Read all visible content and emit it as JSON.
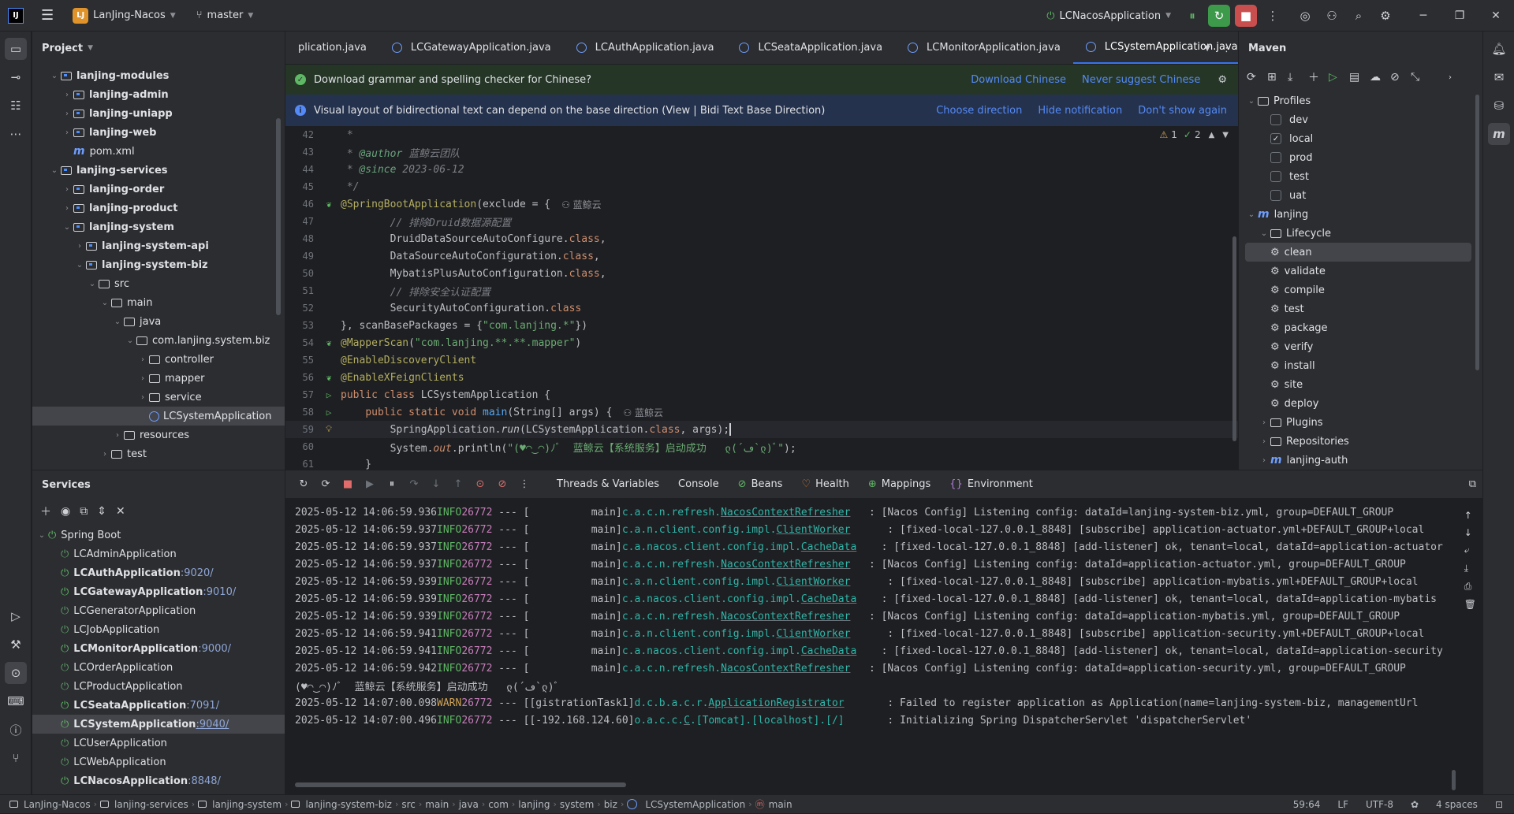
{
  "titlebar": {
    "logo": "IJ",
    "project_badge": "LJ",
    "project_name": "LanJing-Nacos",
    "branch": "master",
    "run_config": "LCNacosApplication"
  },
  "project_panel": {
    "title": "Project",
    "tree": [
      {
        "label": "lanjing-modules",
        "indent": 1,
        "chev": "v",
        "icon": "module",
        "bold": true
      },
      {
        "label": "lanjing-admin",
        "indent": 2,
        "chev": ">",
        "icon": "module",
        "bold": true
      },
      {
        "label": "lanjing-uniapp",
        "indent": 2,
        "chev": ">",
        "icon": "module",
        "bold": true
      },
      {
        "label": "lanjing-web",
        "indent": 2,
        "chev": ">",
        "icon": "module",
        "bold": true
      },
      {
        "label": "pom.xml",
        "indent": 2,
        "chev": "",
        "icon": "maven",
        "bold": false
      },
      {
        "label": "lanjing-services",
        "indent": 1,
        "chev": "v",
        "icon": "module",
        "bold": true
      },
      {
        "label": "lanjing-order",
        "indent": 2,
        "chev": ">",
        "icon": "module",
        "bold": true
      },
      {
        "label": "lanjing-product",
        "indent": 2,
        "chev": ">",
        "icon": "module",
        "bold": true
      },
      {
        "label": "lanjing-system",
        "indent": 2,
        "chev": "v",
        "icon": "module",
        "bold": true
      },
      {
        "label": "lanjing-system-api",
        "indent": 3,
        "chev": ">",
        "icon": "module",
        "bold": true
      },
      {
        "label": "lanjing-system-biz",
        "indent": 3,
        "chev": "v",
        "icon": "module",
        "bold": true
      },
      {
        "label": "src",
        "indent": 4,
        "chev": "v",
        "icon": "folder",
        "bold": false
      },
      {
        "label": "main",
        "indent": 5,
        "chev": "v",
        "icon": "folder",
        "bold": false
      },
      {
        "label": "java",
        "indent": 6,
        "chev": "v",
        "icon": "folder",
        "bold": false
      },
      {
        "label": "com.lanjing.system.biz",
        "indent": 7,
        "chev": "v",
        "icon": "folder",
        "bold": false
      },
      {
        "label": "controller",
        "indent": 8,
        "chev": ">",
        "icon": "folder",
        "bold": false
      },
      {
        "label": "mapper",
        "indent": 8,
        "chev": ">",
        "icon": "folder",
        "bold": false
      },
      {
        "label": "service",
        "indent": 8,
        "chev": ">",
        "icon": "folder",
        "bold": false
      },
      {
        "label": "LCSystemApplication",
        "indent": 8,
        "chev": "",
        "icon": "java",
        "bold": false,
        "selected": true
      },
      {
        "label": "resources",
        "indent": 6,
        "chev": ">",
        "icon": "folder",
        "bold": false
      },
      {
        "label": "test",
        "indent": 5,
        "chev": ">",
        "icon": "folder",
        "bold": false
      }
    ]
  },
  "editor": {
    "tabs": [
      {
        "label": "plication.java",
        "active": false
      },
      {
        "label": "LCGatewayApplication.java",
        "active": false
      },
      {
        "label": "LCAuthApplication.java",
        "active": false
      },
      {
        "label": "LCSeataApplication.java",
        "active": false
      },
      {
        "label": "LCMonitorApplication.java",
        "active": false
      },
      {
        "label": "LCSystemApplication.java",
        "active": true
      }
    ],
    "notification_grammar": {
      "text": "Download grammar and spelling checker for Chinese?",
      "link1": "Download Chinese",
      "link2": "Never suggest Chinese"
    },
    "notification_bidi": {
      "text": "Visual layout of bidirectional text can depend on the base direction (View | Bidi Text Base Direction)",
      "link1": "Choose direction",
      "link2": "Hide notification",
      "link3": "Don't show again"
    },
    "inspections": {
      "warnings": "1",
      "checks": "2"
    },
    "author_hint": "蓝鲸云",
    "lines": [
      {
        "n": "42",
        "html": "<span class='c-com'> *</span>"
      },
      {
        "n": "43",
        "html": "<span class='c-com'> * </span><span class='c-tag'>@author</span><span class='c-com'> 蓝鲸云团队</span>"
      },
      {
        "n": "44",
        "html": "<span class='c-com'> * </span><span class='c-tag'>@since</span><span class='c-com'> 2023-06-12</span>"
      },
      {
        "n": "45",
        "html": "<span class='c-com'> */</span>"
      },
      {
        "n": "46",
        "html": "<span class='c-ann'>@SpringBootApplication</span>(exclude = {",
        "gutter": "bean",
        "author": true
      },
      {
        "n": "47",
        "html": "        <span class='c-com'>// 排除Druid数据源配置</span>"
      },
      {
        "n": "48",
        "html": "        DruidDataSourceAutoConfigure.<span class='c-kw'>class</span>,"
      },
      {
        "n": "49",
        "html": "        DataSourceAutoConfiguration.<span class='c-kw'>class</span>,"
      },
      {
        "n": "50",
        "html": "        MybatisPlusAutoConfiguration.<span class='c-kw'>class</span>,"
      },
      {
        "n": "51",
        "html": "        <span class='c-com'>// 排除安全认证配置</span>"
      },
      {
        "n": "52",
        "html": "        SecurityAutoConfiguration.<span class='c-kw'>class</span>"
      },
      {
        "n": "53",
        "html": "}, scanBasePackages = {<span class='c-str'>\"com.lanjing.*\"</span>})"
      },
      {
        "n": "54",
        "html": "<span class='c-ann'>@MapperScan</span>(<span class='c-str'>\"com.lanjing.**.**.mapper\"</span>)",
        "gutter": "bean"
      },
      {
        "n": "55",
        "html": "<span class='c-ann'>@EnableDiscoveryClient</span>"
      },
      {
        "n": "56",
        "html": "<span class='c-ann'>@EnableXFeignClients</span>",
        "gutter": "bean"
      },
      {
        "n": "57",
        "html": "<span class='c-kw'>public class</span> LCSystemApplication {",
        "gutter": "run"
      },
      {
        "n": "58",
        "html": "    <span class='c-kw'>public static void</span> <span class='c-fn'>main</span>(String[] args) {",
        "gutter": "run",
        "author": true
      },
      {
        "n": "59",
        "html": "        SpringApplication.<span class='c-it'>run</span>(LCSystemApplication.<span class='c-kw'>class</span>, args);",
        "gutter": "bulb",
        "current": true
      },
      {
        "n": "60",
        "html": "        System.<span class='c-kw c-it'>out</span>.println(<span class='c-str'>\"(♥◠‿◠)ﾉﾞ  蓝鲸云【系统服务】启动成功   ლ(´ڡ`ლ)ﾞ\"</span>);"
      },
      {
        "n": "61",
        "html": "    }"
      }
    ]
  },
  "maven": {
    "title": "Maven",
    "tree": [
      {
        "label": "Profiles",
        "indent": 0,
        "chev": "v",
        "icon": "folder"
      },
      {
        "label": "dev",
        "indent": 2,
        "icon": "checkbox",
        "checked": false
      },
      {
        "label": "local",
        "indent": 2,
        "icon": "checkbox",
        "checked": true
      },
      {
        "label": "prod",
        "indent": 2,
        "icon": "checkbox",
        "checked": false
      },
      {
        "label": "test",
        "indent": 2,
        "icon": "checkbox",
        "checked": false
      },
      {
        "label": "uat",
        "indent": 2,
        "icon": "checkbox",
        "checked": false
      },
      {
        "label": "lanjing",
        "indent": 0,
        "chev": "v",
        "icon": "maven"
      },
      {
        "label": "Lifecycle",
        "indent": 1,
        "chev": "v",
        "icon": "folder"
      },
      {
        "label": "clean",
        "indent": 2,
        "icon": "gear",
        "selected": true
      },
      {
        "label": "validate",
        "indent": 2,
        "icon": "gear"
      },
      {
        "label": "compile",
        "indent": 2,
        "icon": "gear"
      },
      {
        "label": "test",
        "indent": 2,
        "icon": "gear"
      },
      {
        "label": "package",
        "indent": 2,
        "icon": "gear"
      },
      {
        "label": "verify",
        "indent": 2,
        "icon": "gear"
      },
      {
        "label": "install",
        "indent": 2,
        "icon": "gear"
      },
      {
        "label": "site",
        "indent": 2,
        "icon": "gear"
      },
      {
        "label": "deploy",
        "indent": 2,
        "icon": "gear"
      },
      {
        "label": "Plugins",
        "indent": 1,
        "chev": ">",
        "icon": "folder"
      },
      {
        "label": "Repositories",
        "indent": 1,
        "chev": ">",
        "icon": "folder"
      },
      {
        "label": "lanjing-auth",
        "indent": 1,
        "chev": ">",
        "icon": "maven"
      }
    ]
  },
  "services": {
    "title": "Services",
    "root": "Spring Boot",
    "apps": [
      {
        "name": "LCAdminApplication",
        "port": "",
        "running": false
      },
      {
        "name": "LCAuthApplication",
        "port": ":9020/",
        "running": true
      },
      {
        "name": "LCGatewayApplication",
        "port": ":9010/",
        "running": true
      },
      {
        "name": "LCGeneratorApplication",
        "port": "",
        "running": false
      },
      {
        "name": "LCJobApplication",
        "port": "",
        "running": false
      },
      {
        "name": "LCMonitorApplication",
        "port": ":9000/",
        "running": true
      },
      {
        "name": "LCOrderApplication",
        "port": "",
        "running": false
      },
      {
        "name": "LCProductApplication",
        "port": "",
        "running": false
      },
      {
        "name": "LCSeataApplication",
        "port": ":7091/",
        "running": true
      },
      {
        "name": "LCSystemApplication",
        "port": ":9040/",
        "running": true,
        "selected": true
      },
      {
        "name": "LCUserApplication",
        "port": "",
        "running": false
      },
      {
        "name": "LCWebApplication",
        "port": "",
        "running": false
      },
      {
        "name": "LCNacosApplication",
        "port": ":8848/",
        "running": true
      }
    ],
    "console_tabs": [
      "Threads & Variables",
      "Console",
      "Beans",
      "Health",
      "Mappings",
      "Environment"
    ],
    "logs": [
      {
        "ts": "2025-05-12 14:06:59.936",
        "lvl": "INFO",
        "pid": "26772",
        "thread": "          main]",
        "logger": "c.a.c.n.refresh.",
        "ul": "NacosContextRefresher",
        "pad": "   ",
        "msg": ": [Nacos Config] Listening config: dataId=lanjing-system-biz.yml, group=DEFAULT_GROUP"
      },
      {
        "ts": "2025-05-12 14:06:59.937",
        "lvl": "INFO",
        "pid": "26772",
        "thread": "          main]",
        "logger": "c.a.n.client.config.impl.",
        "ul": "ClientWorker",
        "pad": "      ",
        "msg": ": [fixed-local-127.0.0.1_8848] [subscribe] application-actuator.yml+DEFAULT_GROUP+local"
      },
      {
        "ts": "2025-05-12 14:06:59.937",
        "lvl": "INFO",
        "pid": "26772",
        "thread": "          main]",
        "logger": "c.a.nacos.client.config.impl.",
        "ul": "CacheData",
        "pad": "    ",
        "msg": ": [fixed-local-127.0.0.1_8848] [add-listener] ok, tenant=local, dataId=application-actuator"
      },
      {
        "ts": "2025-05-12 14:06:59.937",
        "lvl": "INFO",
        "pid": "26772",
        "thread": "          main]",
        "logger": "c.a.c.n.refresh.",
        "ul": "NacosContextRefresher",
        "pad": "   ",
        "msg": ": [Nacos Config] Listening config: dataId=application-actuator.yml, group=DEFAULT_GROUP"
      },
      {
        "ts": "2025-05-12 14:06:59.939",
        "lvl": "INFO",
        "pid": "26772",
        "thread": "          main]",
        "logger": "c.a.n.client.config.impl.",
        "ul": "ClientWorker",
        "pad": "      ",
        "msg": ": [fixed-local-127.0.0.1_8848] [subscribe] application-mybatis.yml+DEFAULT_GROUP+local"
      },
      {
        "ts": "2025-05-12 14:06:59.939",
        "lvl": "INFO",
        "pid": "26772",
        "thread": "          main]",
        "logger": "c.a.nacos.client.config.impl.",
        "ul": "CacheData",
        "pad": "    ",
        "msg": ": [fixed-local-127.0.0.1_8848] [add-listener] ok, tenant=local, dataId=application-mybatis"
      },
      {
        "ts": "2025-05-12 14:06:59.939",
        "lvl": "INFO",
        "pid": "26772",
        "thread": "          main]",
        "logger": "c.a.c.n.refresh.",
        "ul": "NacosContextRefresher",
        "pad": "   ",
        "msg": ": [Nacos Config] Listening config: dataId=application-mybatis.yml, group=DEFAULT_GROUP"
      },
      {
        "ts": "2025-05-12 14:06:59.941",
        "lvl": "INFO",
        "pid": "26772",
        "thread": "          main]",
        "logger": "c.a.n.client.config.impl.",
        "ul": "ClientWorker",
        "pad": "      ",
        "msg": ": [fixed-local-127.0.0.1_8848] [subscribe] application-security.yml+DEFAULT_GROUP+local"
      },
      {
        "ts": "2025-05-12 14:06:59.941",
        "lvl": "INFO",
        "pid": "26772",
        "thread": "          main]",
        "logger": "c.a.nacos.client.config.impl.",
        "ul": "CacheData",
        "pad": "    ",
        "msg": ": [fixed-local-127.0.0.1_8848] [add-listener] ok, tenant=local, dataId=application-security"
      },
      {
        "ts": "2025-05-12 14:06:59.942",
        "lvl": "INFO",
        "pid": "26772",
        "thread": "          main]",
        "logger": "c.a.c.n.refresh.",
        "ul": "NacosContextRefresher",
        "pad": "   ",
        "msg": ": [Nacos Config] Listening config: dataId=application-security.yml, group=DEFAULT_GROUP"
      },
      {
        "plain": "(♥◠‿◠)ﾉﾞ  蓝鲸云【系统服务】启动成功   ლ(´ڡ`ლ)ﾞ"
      },
      {
        "ts": "2025-05-12 14:07:00.098",
        "lvl": "WARN",
        "pid": "26772",
        "thread": "[gistrationTask1]",
        "logger": "d.c.b.a.c.r.",
        "ul": "ApplicationRegistrator",
        "pad": "       ",
        "msg": ": Failed to register application as Application(name=lanjing-system-biz, managementUrl"
      },
      {
        "ts": "2025-05-12 14:07:00.496",
        "lvl": "INFO",
        "pid": "26772",
        "thread": "[-192.168.124.60]",
        "logger": "o.a.c.c.",
        "ul": "C",
        "post": ".[Tomcat].[localhost].[/]",
        "pad": "       ",
        "msg": ": Initializing Spring DispatcherServlet 'dispatcherServlet'"
      }
    ]
  },
  "statusbar": {
    "crumbs": [
      "LanJing-Nacos",
      "lanjing-services",
      "lanjing-system",
      "lanjing-system-biz",
      "src",
      "main",
      "java",
      "com",
      "lanjing",
      "system",
      "biz",
      "LCSystemApplication",
      "main"
    ],
    "position": "59:64",
    "line_sep": "LF",
    "encoding": "UTF-8",
    "indent": "4 spaces"
  },
  "colors": {
    "accent": "#3574f0",
    "running": "#5fb865",
    "warn": "#d0a254"
  }
}
